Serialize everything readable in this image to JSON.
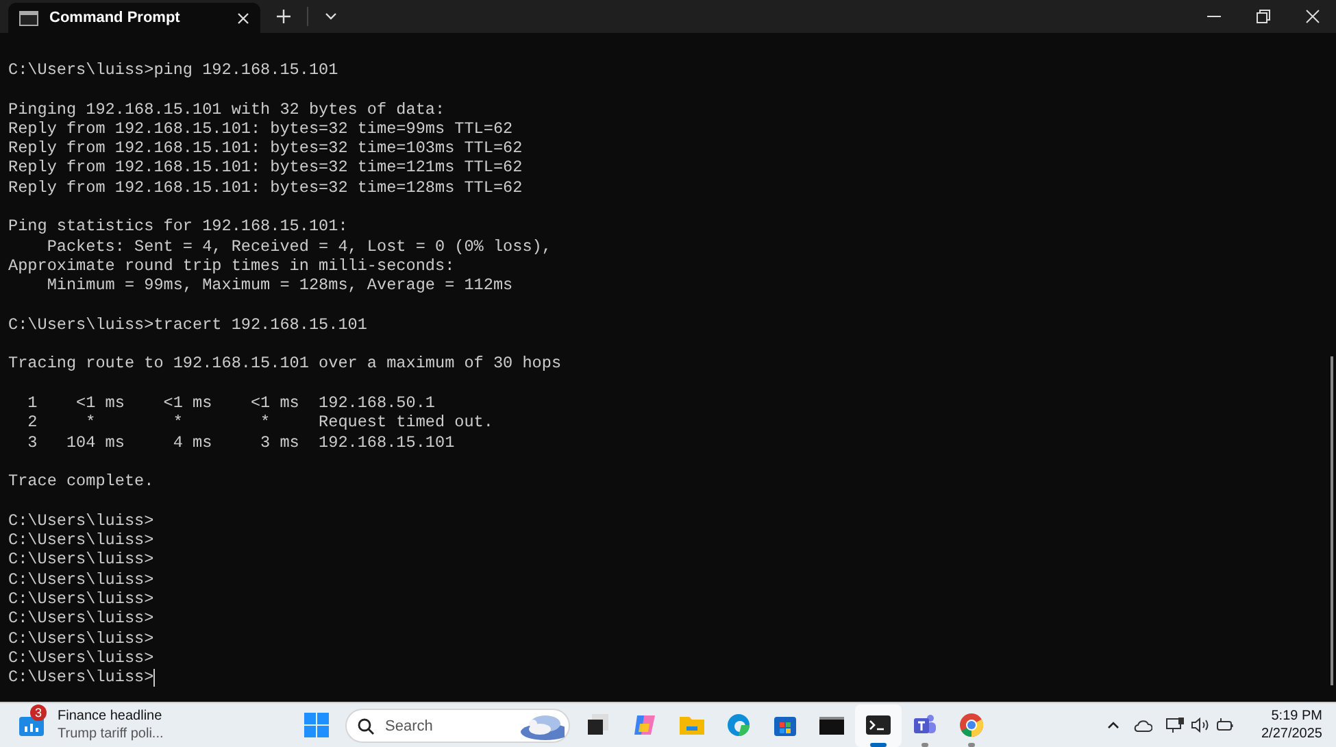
{
  "window": {
    "tab": {
      "title": "Command Prompt",
      "selected": true
    }
  },
  "terminal": {
    "blocks": [
      [
        "C:\\Users\\luiss>ping 192.168.15.101"
      ],
      [
        "Pinging 192.168.15.101 with 32 bytes of data:",
        "Reply from 192.168.15.101: bytes=32 time=99ms TTL=62",
        "Reply from 192.168.15.101: bytes=32 time=103ms TTL=62",
        "Reply from 192.168.15.101: bytes=32 time=121ms TTL=62",
        "Reply from 192.168.15.101: bytes=32 time=128ms TTL=62"
      ],
      [
        "Ping statistics for 192.168.15.101:",
        "    Packets: Sent = 4, Received = 4, Lost = 0 (0% loss),",
        "Approximate round trip times in milli-seconds:",
        "    Minimum = 99ms, Maximum = 128ms, Average = 112ms"
      ],
      [
        "C:\\Users\\luiss>tracert 192.168.15.101"
      ],
      [
        "Tracing route to 192.168.15.101 over a maximum of 30 hops"
      ],
      [
        "  1    <1 ms    <1 ms    <1 ms  192.168.50.1",
        "  2     *        *        *     Request timed out.",
        "  3   104 ms     4 ms     3 ms  192.168.15.101"
      ],
      [
        "Trace complete."
      ],
      [
        "C:\\Users\\luiss>",
        "C:\\Users\\luiss>",
        "C:\\Users\\luiss>",
        "C:\\Users\\luiss>",
        "C:\\Users\\luiss>",
        "C:\\Users\\luiss>",
        "C:\\Users\\luiss>",
        "C:\\Users\\luiss>",
        "C:\\Users\\luiss>"
      ]
    ]
  },
  "taskbar": {
    "widget": {
      "badge": "3",
      "title": "Finance headline",
      "subtitle": "Trump tariff poli..."
    },
    "search": {
      "placeholder": "Search"
    },
    "apps": [
      {
        "kind": "taskview",
        "selected": false,
        "running": false
      },
      {
        "kind": "copilot",
        "selected": false,
        "running": false
      },
      {
        "kind": "folder",
        "selected": false,
        "running": false
      },
      {
        "kind": "edge",
        "selected": false,
        "running": false
      },
      {
        "kind": "store",
        "selected": false,
        "running": false
      },
      {
        "kind": "cmd",
        "selected": false,
        "running": false
      },
      {
        "kind": "terminal",
        "selected": true,
        "running": true
      },
      {
        "kind": "teams",
        "selected": false,
        "running": true
      },
      {
        "kind": "chrome",
        "selected": false,
        "running": true
      }
    ],
    "clock": {
      "time": "5:19 PM",
      "date": "2/27/2025"
    }
  }
}
